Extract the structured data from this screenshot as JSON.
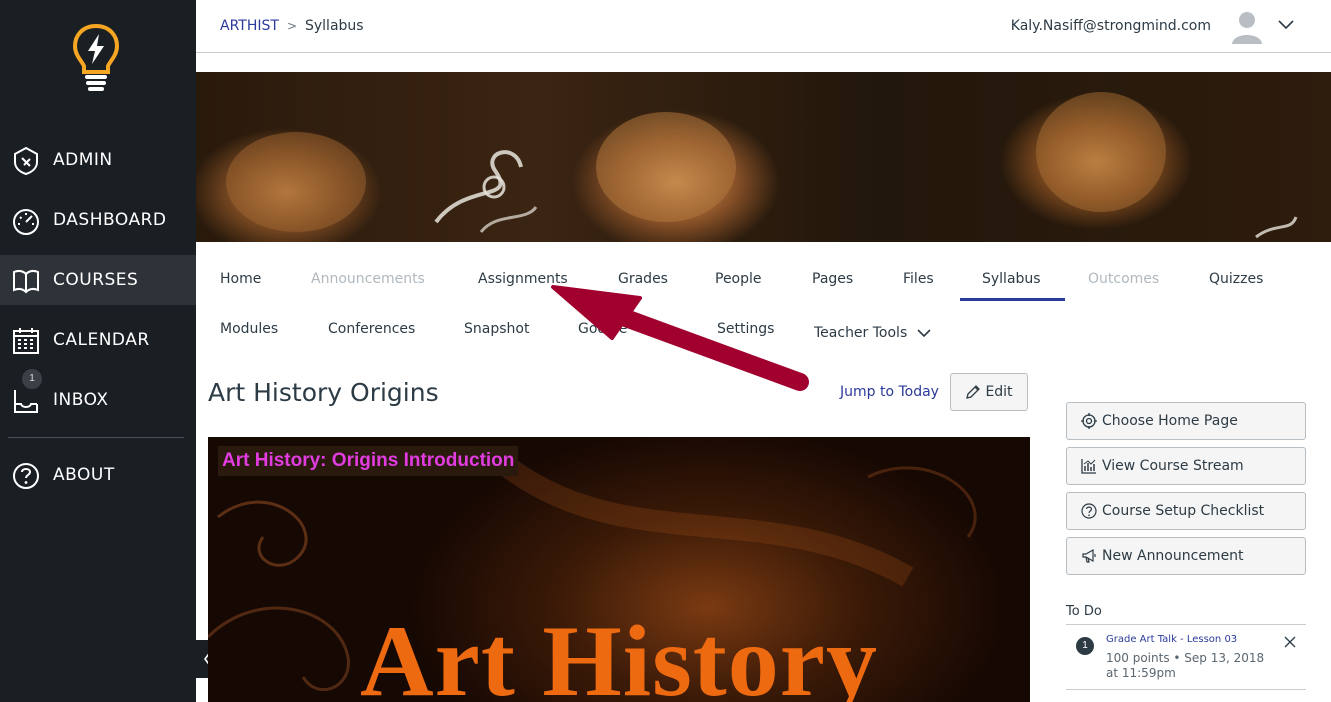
{
  "sidebar": {
    "items": [
      {
        "label": "ADMIN",
        "icon": "admin-shield-icon"
      },
      {
        "label": "DASHBOARD",
        "icon": "dashboard-gauge-icon"
      },
      {
        "label": "COURSES",
        "icon": "book-icon"
      },
      {
        "label": "CALENDAR",
        "icon": "calendar-icon"
      },
      {
        "label": "INBOX",
        "icon": "inbox-icon",
        "badge": "1"
      },
      {
        "label": "ABOUT",
        "icon": "help-circle-icon"
      }
    ],
    "active": "COURSES"
  },
  "header": {
    "breadcrumb_course": "ARTHIST",
    "breadcrumb_current": "Syllabus",
    "user_email": "Kaly.Nasiff@strongmind.com"
  },
  "tabs": [
    {
      "label": "Home",
      "state": "normal"
    },
    {
      "label": "Announcements",
      "state": "disabled"
    },
    {
      "label": "Assignments",
      "state": "normal"
    },
    {
      "label": "Grades",
      "state": "normal"
    },
    {
      "label": "People",
      "state": "normal"
    },
    {
      "label": "Pages",
      "state": "normal"
    },
    {
      "label": "Files",
      "state": "normal"
    },
    {
      "label": "Syllabus",
      "state": "active"
    },
    {
      "label": "Outcomes",
      "state": "disabled"
    },
    {
      "label": "Quizzes",
      "state": "normal"
    },
    {
      "label": "Modules",
      "state": "normal"
    },
    {
      "label": "Conferences",
      "state": "normal"
    },
    {
      "label": "Snapshot",
      "state": "normal"
    },
    {
      "label": "Google",
      "state": "normal"
    },
    {
      "label": "Settings",
      "state": "normal"
    },
    {
      "label": "Teacher Tools",
      "state": "dropdown"
    }
  ],
  "main": {
    "title": "Art History Origins",
    "jump_to_today": "Jump to Today",
    "edit_label": "Edit",
    "content_caption": "Art History: Origins Introduction",
    "content_headline": "Art History"
  },
  "right_panel": {
    "buttons": [
      {
        "label": "Choose Home Page",
        "icon": "target-icon"
      },
      {
        "label": "View Course Stream",
        "icon": "stream-chart-icon"
      },
      {
        "label": "Course Setup Checklist",
        "icon": "question-circle-icon"
      },
      {
        "label": "New Announcement",
        "icon": "megaphone-icon"
      }
    ],
    "todo_heading": "To Do",
    "todo_items": [
      {
        "number": "1",
        "title": "Grade Art Talk - Lesson 03",
        "meta": "100 points • Sep 13, 2018 at 11:59pm"
      }
    ]
  },
  "colors": {
    "sidebar_bg": "#1a1f24",
    "link_blue": "#2b3a9b",
    "annotation_arrow": "#a1002f",
    "caption_magenta": "#e23be0",
    "headline_orange": "#ee6a10"
  }
}
